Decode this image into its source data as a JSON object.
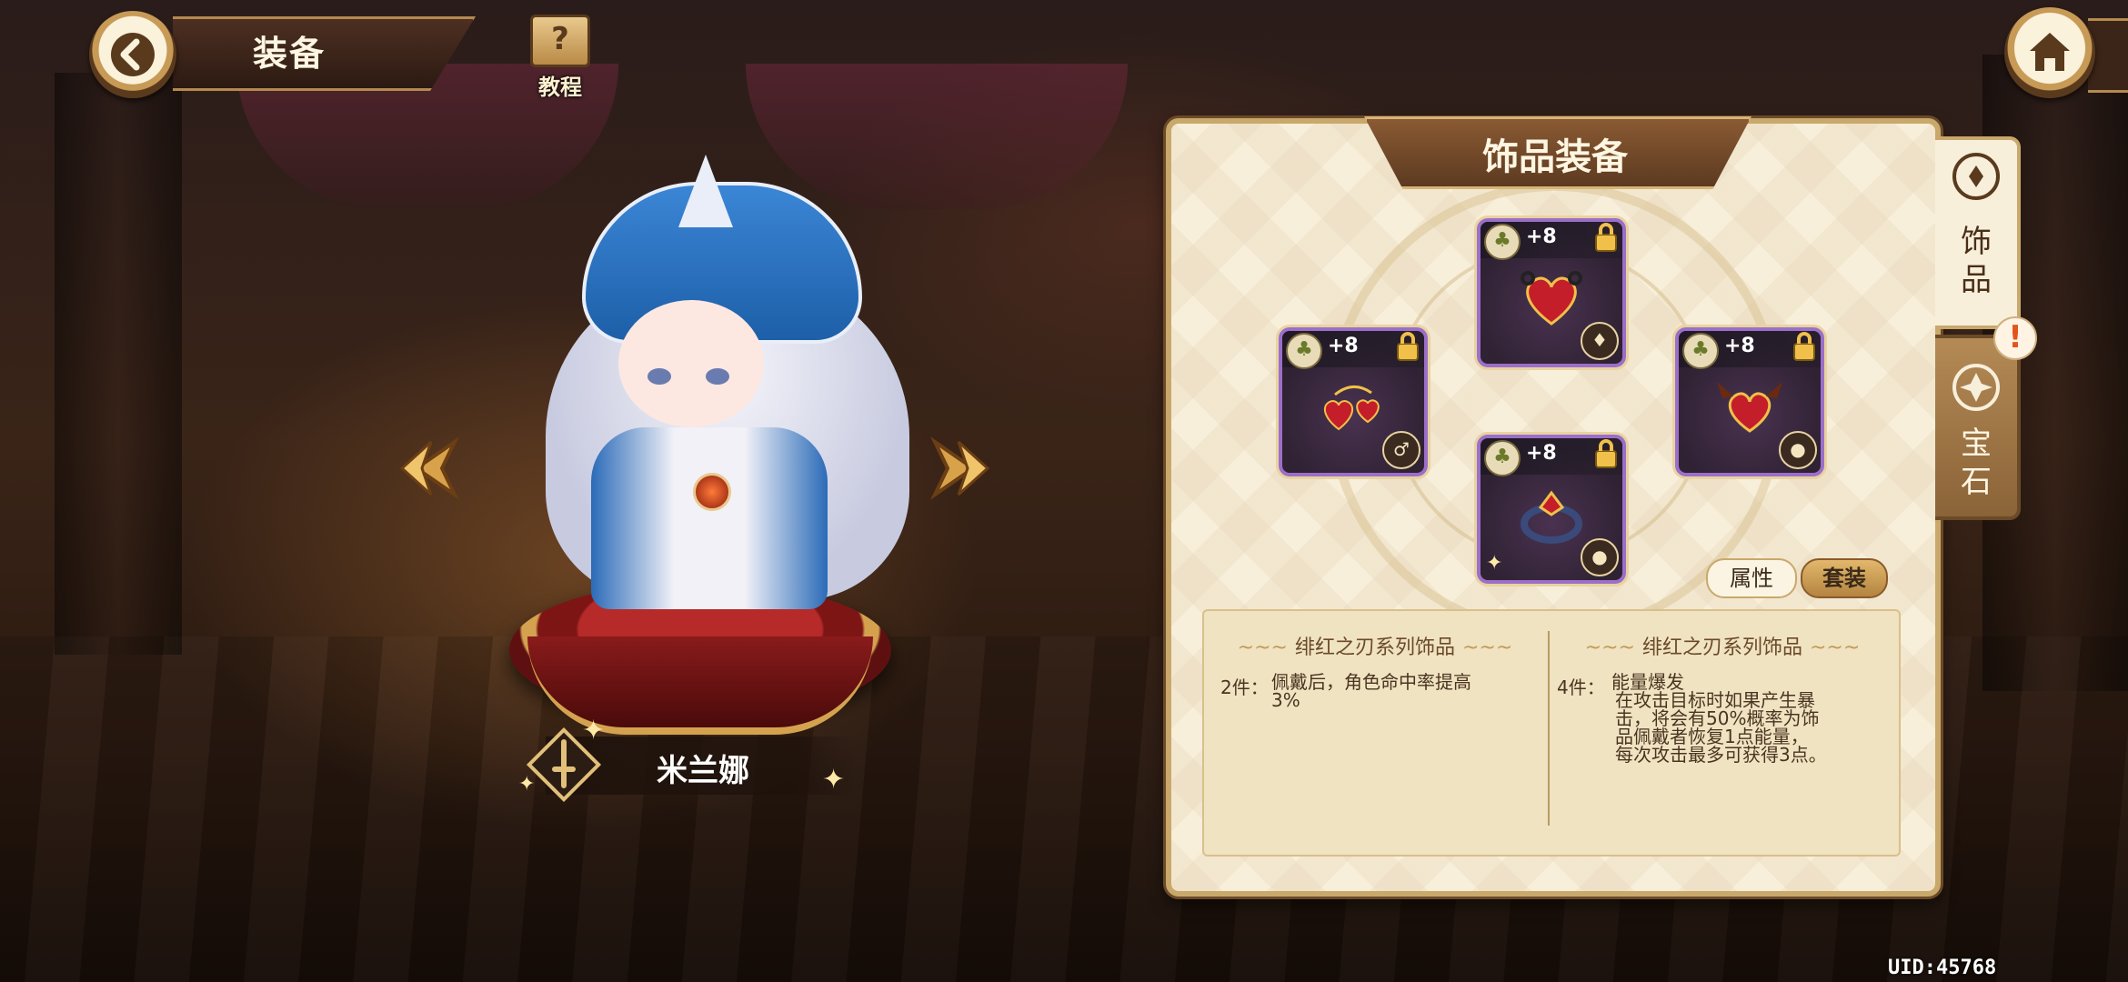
{
  "header": {
    "title": "装备",
    "help_label": "教程"
  },
  "character": {
    "name": "米兰娜"
  },
  "panel": {
    "title": "饰品装备",
    "slots": [
      {
        "id": "top",
        "level": "+8",
        "type_icon": "drop-icon",
        "item": "heart-chain"
      },
      {
        "id": "left",
        "level": "+8",
        "type_icon": "pendant-icon",
        "item": "heart-earrings"
      },
      {
        "id": "right",
        "level": "+8",
        "type_icon": "seed-icon",
        "item": "winged-heart"
      },
      {
        "id": "bottom",
        "level": "+8",
        "type_icon": "seed-icon",
        "item": "ruby-ring"
      }
    ],
    "tabs": {
      "attributes": "属性",
      "set": "套装"
    },
    "set_bonus": [
      {
        "title": "绯红之刃系列饰品",
        "count": "2件：",
        "lines": [
          "佩戴后，角色命中率提高",
          "3%"
        ]
      },
      {
        "title": "绯红之刃系列饰品",
        "count": "4件：",
        "lines": [
          "能量爆发",
          "在攻击目标时如果产生暴",
          "击，将会有50%概率为饰",
          "品佩戴者恢复1点能量，",
          "每次攻击最多可获得3点。"
        ]
      }
    ]
  },
  "side_tabs": [
    {
      "label_1": "饰",
      "label_2": "品",
      "active": true
    },
    {
      "label_1": "宝",
      "label_2": "石",
      "active": false,
      "alert": "!"
    }
  ],
  "footer": {
    "uid": "UID:45768"
  },
  "colors": {
    "panel_bg": "#f8efdb",
    "panel_border": "#c9a86b",
    "slot_border": "#9b6fc9",
    "alert": "#e2561e"
  }
}
